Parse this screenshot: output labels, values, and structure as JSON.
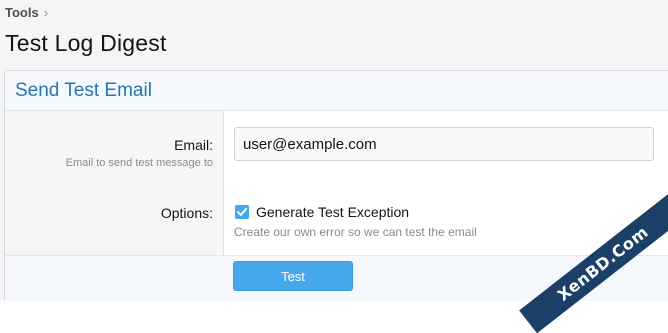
{
  "breadcrumb": {
    "item": "Tools",
    "separator": "›"
  },
  "page": {
    "title": "Test Log Digest"
  },
  "section": {
    "title": "Send Test Email"
  },
  "form": {
    "email": {
      "label": "Email:",
      "hint": "Email to send test message to",
      "value": "user@example.com"
    },
    "options": {
      "label": "Options:",
      "checkbox_label": "Generate Test Exception",
      "checkbox_checked": true,
      "hint": "Create our own error so we can test the email"
    },
    "submit_label": "Test"
  },
  "watermark": {
    "text": "XenBD.Com"
  },
  "colors": {
    "accent": "#47a7eb",
    "header_text": "#2577b1",
    "watermark_bg": "#1b3f66"
  },
  "icons": {
    "checkbox": "checkmark-icon",
    "breadcrumb_sep": "chevron-right-icon"
  }
}
